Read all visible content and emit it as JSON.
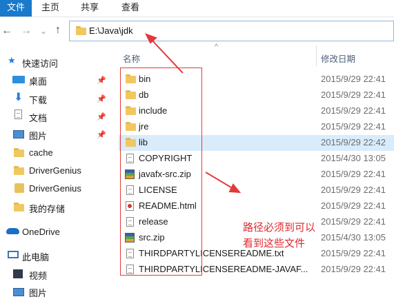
{
  "ribbon": {
    "tabs": [
      "文件",
      "主页",
      "共享",
      "查看"
    ]
  },
  "address": {
    "path": "E:\\Java\\jdk"
  },
  "nav": {
    "back": "←",
    "forward": "→",
    "recent": "⌄",
    "up": "↑"
  },
  "sidebar": {
    "items": [
      {
        "label": "快速访问",
        "icon": "star-icon"
      },
      {
        "label": "桌面",
        "icon": "desktop-icon",
        "pinned": true
      },
      {
        "label": "下载",
        "icon": "download-icon",
        "pinned": true
      },
      {
        "label": "文档",
        "icon": "document-icon",
        "pinned": true
      },
      {
        "label": "图片",
        "icon": "pictures-icon",
        "pinned": true
      },
      {
        "label": "cache",
        "icon": "folder-icon"
      },
      {
        "label": "DriverGenius",
        "icon": "folder-icon"
      },
      {
        "label": "DriverGenius",
        "icon": "app-icon"
      },
      {
        "label": "我的存储",
        "icon": "folder-icon"
      },
      {
        "label": "OneDrive",
        "icon": "onedrive-icon"
      },
      {
        "label": "此电脑",
        "icon": "pc-icon"
      },
      {
        "label": "视频",
        "icon": "video-icon"
      },
      {
        "label": "图片",
        "icon": "pictures-icon"
      }
    ],
    "pin_glyph": "📌"
  },
  "columns": {
    "name": "名称",
    "date": "修改日期",
    "sort_glyph": "^"
  },
  "files": [
    {
      "name": "bin",
      "date": "2015/9/29 22:41",
      "type": "folder"
    },
    {
      "name": "db",
      "date": "2015/9/29 22:41",
      "type": "folder"
    },
    {
      "name": "include",
      "date": "2015/9/29 22:41",
      "type": "folder"
    },
    {
      "name": "jre",
      "date": "2015/9/29 22:41",
      "type": "folder"
    },
    {
      "name": "lib",
      "date": "2015/9/29 22:42",
      "type": "folder",
      "selected": true
    },
    {
      "name": "COPYRIGHT",
      "date": "2015/4/30 13:05",
      "type": "file"
    },
    {
      "name": "javafx-src.zip",
      "date": "2015/9/29 22:41",
      "type": "zip"
    },
    {
      "name": "LICENSE",
      "date": "2015/9/29 22:41",
      "type": "file"
    },
    {
      "name": "README.html",
      "date": "2015/9/29 22:41",
      "type": "html"
    },
    {
      "name": "release",
      "date": "2015/9/29 22:41",
      "type": "file"
    },
    {
      "name": "src.zip",
      "date": "2015/4/30 13:05",
      "type": "zip"
    },
    {
      "name": "THIRDPARTYLICENSEREADME.txt",
      "date": "2015/9/29 22:41",
      "type": "file"
    },
    {
      "name": "THIRDPARTYLICENSEREADME-JAVAF...",
      "date": "2015/9/29 22:41",
      "type": "file"
    }
  ],
  "annotation": {
    "line1": "路径必须到可以",
    "line2": "看到这些文件",
    "color": "#e0282e"
  },
  "colors": {
    "accent": "#1979ca",
    "selection": "#d9ecfb"
  }
}
